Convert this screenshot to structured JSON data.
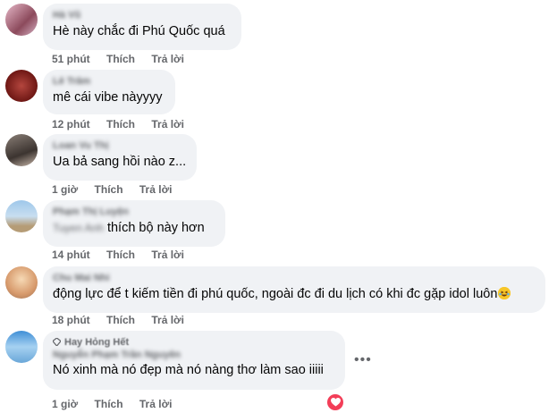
{
  "comments": [
    {
      "author": "Hà Vũ",
      "text": "Hè này chắc đi Phú Quốc quá",
      "time": "51 phút",
      "like": "Thích",
      "reply": "Trả lời"
    },
    {
      "author": "Lê Trâm",
      "text": "mê cái vibe nàyyyy",
      "time": "12 phút",
      "like": "Thích",
      "reply": "Trả lời"
    },
    {
      "author": "Loan Vu Thị",
      "text": "Ua bả sang hồi nào z...",
      "time": "1 giờ",
      "like": "Thích",
      "reply": "Trả lời"
    },
    {
      "author": "Phạm Thị Luyện",
      "mention": "Tuyen Anh",
      "text": "thích bộ này hơn",
      "time": "14 phút",
      "like": "Thích",
      "reply": "Trả lời"
    },
    {
      "author": "Chu Mai Nhi",
      "text": "động lực để t kiếm tiền đi phú quốc, ngoài đc đi du lịch có khi đc gặp idol luôn",
      "time": "18 phút",
      "like": "Thích",
      "reply": "Trả lời"
    },
    {
      "badge": "Hay Hỏng Hết",
      "author": "Nguyễn Phạm Trần Nguyên",
      "text": "Nó xinh mà nó đẹp mà nó nàng thơ làm sao iiiii",
      "time": "1 giờ",
      "like": "Thích",
      "reply": "Trả lời"
    }
  ],
  "icons": {
    "more": "more-options-icon",
    "heart": "heart-reaction-icon",
    "emoji": "laughing-emoji-icon",
    "badge": "top-fan-badge-icon"
  },
  "colors": {
    "bubble": "#f0f2f5",
    "meta": "#65676b",
    "heart": "#f33e58"
  }
}
